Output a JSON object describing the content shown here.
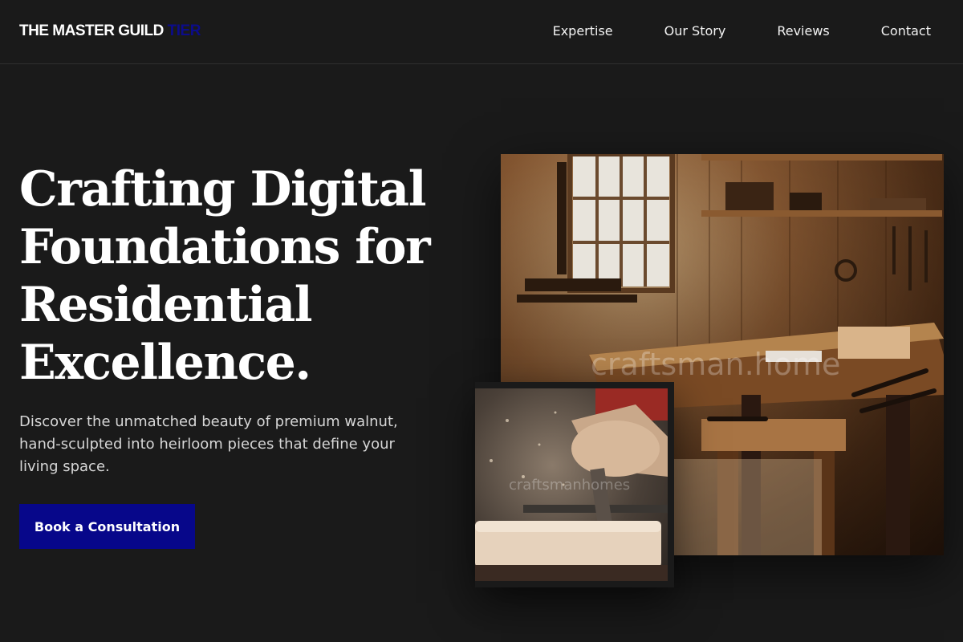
{
  "header": {
    "logo_main": "THE MASTER GUILD",
    "logo_accent": "TIER",
    "nav": [
      {
        "label": "Expertise"
      },
      {
        "label": "Our Story"
      },
      {
        "label": "Reviews"
      },
      {
        "label": "Contact"
      }
    ]
  },
  "hero": {
    "headline_lines": [
      "Crafting Digital",
      "Foundations for",
      "Residential",
      "Excellence."
    ],
    "subtitle": "Discover the unmatched beauty of premium walnut, hand-sculpted into heirloom pieces that define your living space.",
    "cta_label": "Book a Consultation"
  },
  "images": {
    "main_watermark": "craftsman.home",
    "inset_watermark": "craftsmanhomes"
  },
  "colors": {
    "background": "#1a1a1a",
    "accent": "#07078a",
    "text": "#ffffff"
  }
}
